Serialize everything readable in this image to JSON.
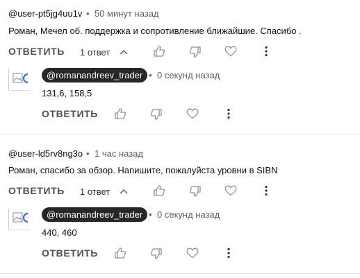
{
  "comments": [
    {
      "author": "@user-pt5jg4uu1v",
      "separator": "•",
      "time": "50 минут назад",
      "text": "Роман, Мечел об. поддержка и сопротивление ближайшие. Спасибо .",
      "reply_label": "ОТВЕТИТЬ",
      "replies_label": "1 ответ",
      "reply": {
        "author": "@romanandreev_trader",
        "separator": "•",
        "time": "0 секунд назад",
        "text": "131,6, 158,5",
        "reply_label": "ОТВЕТИТЬ"
      }
    },
    {
      "author": "@user-ld5rv8ng3o",
      "separator": "•",
      "time": "1 час назад",
      "text": "Роман,  спасибо за обзор. Напишите, пожалуйста уровни в SIBN",
      "reply_label": "ОТВЕТИТЬ",
      "replies_label": "1 ответ",
      "reply": {
        "author": "@romanandreev_trader",
        "separator": "•",
        "time": "0 секунд назад",
        "text": "440, 460",
        "reply_label": "ОТВЕТИТЬ"
      }
    }
  ],
  "icons": [
    "chevron-up-icon",
    "thumbs-up-icon",
    "thumbs-down-icon",
    "heart-icon",
    "more-vertical-icon",
    "broken-image-icon"
  ],
  "colors": {
    "pill_bg": "#272727",
    "text_secondary": "#606060",
    "icon": "#909090"
  }
}
